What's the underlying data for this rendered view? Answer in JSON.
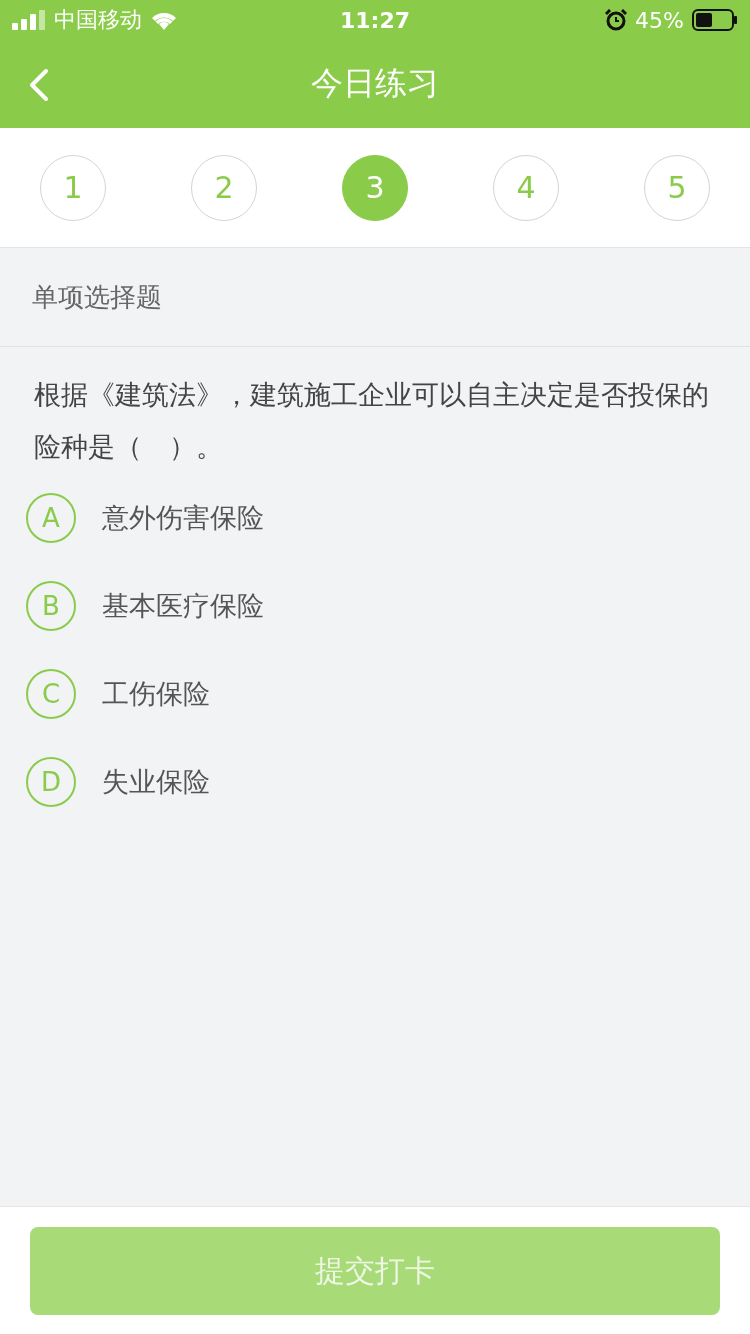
{
  "status_bar": {
    "carrier": "中国移动",
    "time": "11:27",
    "battery": "45%"
  },
  "nav": {
    "title": "今日练习"
  },
  "steps": [
    {
      "label": "1",
      "selected": false
    },
    {
      "label": "2",
      "selected": false
    },
    {
      "label": "3",
      "selected": true
    },
    {
      "label": "4",
      "selected": false
    },
    {
      "label": "5",
      "selected": false
    }
  ],
  "question": {
    "type_label": "单项选择题",
    "text": "根据《建筑法》，建筑施工企业可以自主决定是否投保的险种是（　）。"
  },
  "options": [
    {
      "letter": "A",
      "text": "意外伤害保险"
    },
    {
      "letter": "B",
      "text": "基本医疗保险"
    },
    {
      "letter": "C",
      "text": "工伤保险"
    },
    {
      "letter": "D",
      "text": "失业保险"
    }
  ],
  "submit": {
    "label": "提交打卡",
    "disabled": true
  }
}
